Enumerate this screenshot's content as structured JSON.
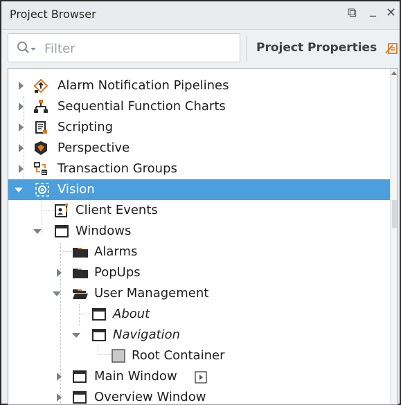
{
  "panel": {
    "title": "Project Browser",
    "controls": {
      "restore": "⧉",
      "minimize": "_",
      "close": "✕"
    }
  },
  "search": {
    "placeholder": "Filter",
    "value": ""
  },
  "project_properties": {
    "label": "Project Properties"
  },
  "colors": {
    "selection": "#4a9fdc",
    "folder": "#2b2b2b",
    "accent_orange": "#e07a1a"
  },
  "tree": {
    "items": [
      {
        "label": "Alarm Notification Pipelines",
        "icon": "alarm-pipeline-icon"
      },
      {
        "label": "Sequential Function Charts",
        "icon": "sfc-icon"
      },
      {
        "label": "Scripting",
        "icon": "scripting-icon"
      },
      {
        "label": "Perspective",
        "icon": "perspective-icon"
      },
      {
        "label": "Transaction Groups",
        "icon": "transaction-groups-icon"
      },
      {
        "label": "Vision",
        "icon": "vision-icon",
        "selected": true
      },
      {
        "label": "Client Events",
        "icon": "client-events-icon"
      },
      {
        "label": "Windows",
        "icon": "window-icon"
      },
      {
        "label": "Alarms",
        "icon": "folder-icon"
      },
      {
        "label": "PopUps",
        "icon": "folder-icon"
      },
      {
        "label": "User Management",
        "icon": "folder-open-icon"
      },
      {
        "label": "About",
        "icon": "window-icon"
      },
      {
        "label": "Navigation",
        "icon": "window-icon"
      },
      {
        "label": "Root Container",
        "icon": "container-icon"
      },
      {
        "label": "Main Window",
        "icon": "window-icon"
      },
      {
        "label": "Overview Window",
        "icon": "window-icon"
      }
    ]
  }
}
